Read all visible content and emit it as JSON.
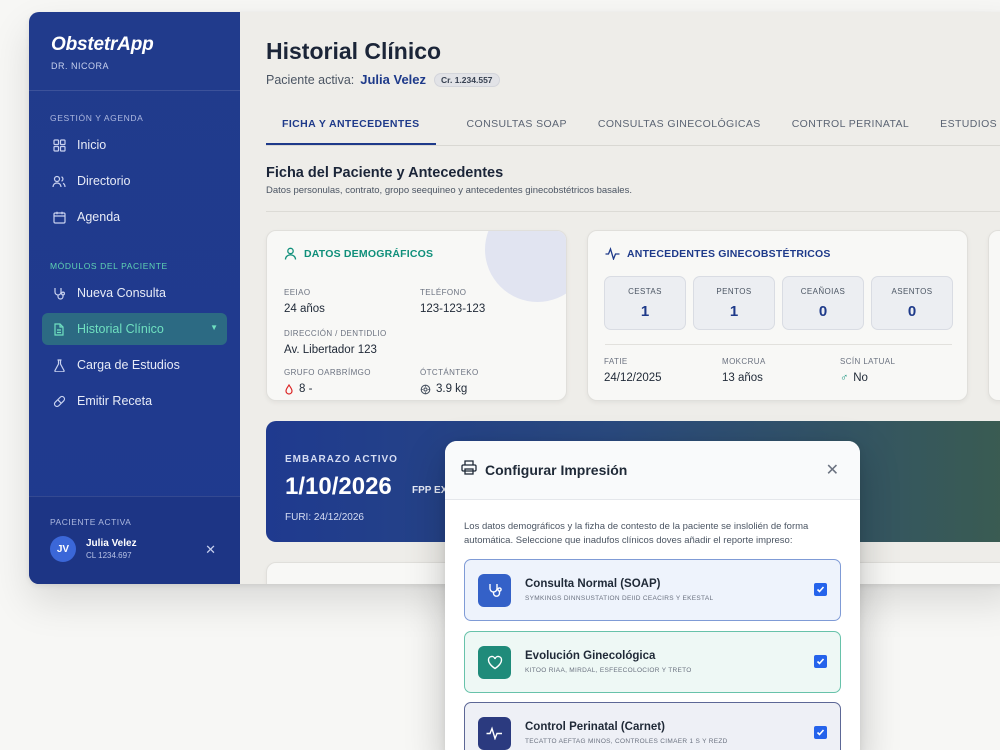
{
  "app": {
    "name": "ObstetrApp",
    "doctor": "DR. NICORA"
  },
  "sidebar": {
    "section1": "GESTIÓN Y AGENDA",
    "items1": [
      {
        "label": "Inicio",
        "icon": "grid-icon"
      },
      {
        "label": "Directorio",
        "icon": "users-icon"
      },
      {
        "label": "Agenda",
        "icon": "calendar-icon"
      }
    ],
    "section2": "MÓDULOS DEL PACIENTE",
    "items2": [
      {
        "label": "Nueva Consulta",
        "icon": "stethoscope-icon"
      },
      {
        "label": "Historial Clínico",
        "icon": "document-icon",
        "active": true
      },
      {
        "label": "Carga de Estudios",
        "icon": "flask-icon"
      },
      {
        "label": "Emitir Receta",
        "icon": "pill-icon"
      }
    ],
    "patient": {
      "label": "PACIENTE ACTIVA",
      "initials": "JV",
      "name": "Julia Velez",
      "id": "CL 1234.697"
    }
  },
  "header": {
    "title": "Historial Clínico",
    "patient_label": "Paciente activa:",
    "patient_name": "Julia Velez",
    "badge": "Cr. 1.234.557"
  },
  "tabs": [
    {
      "label": "FICHA Y ANTECEDENTES",
      "active": true
    },
    {
      "label": "CONSULTAS SOAP"
    },
    {
      "label": "CONSULTAS GINECOLÓGICAS"
    },
    {
      "label": "CONTROL PERINATAL"
    },
    {
      "label": "ESTUDIOS Y EXÁMENES"
    }
  ],
  "section": {
    "title": "Ficha del Paciente y Antecedentes",
    "description": "Datos personulas, contrato, gropo seequineo y antecedentes ginecobstétricos basales."
  },
  "demographics": {
    "title": "DATOS DEMOGRÁFICOS",
    "age_label": "EEIAO",
    "age": "24 años",
    "phone_label": "TELÉFONO",
    "phone": "123-123-123",
    "address_label": "DIRECCIÓN / DENTIDLIO",
    "address": "Av. Libertador 123",
    "blood_label": "GRUFO OARBRÍMGO",
    "blood": "8 -",
    "weight_label": "ÓTCTÁNTEKO",
    "weight": "3.9 kg"
  },
  "antecedents": {
    "title": "ANTECEDENTES GINECOBSTÉTRICOS",
    "stats": [
      {
        "label": "CESTAS",
        "value": "1"
      },
      {
        "label": "PENTOS",
        "value": "1"
      },
      {
        "label": "CEAÑOIAS",
        "value": "0"
      },
      {
        "label": "ASENTOS",
        "value": "0"
      }
    ],
    "date_label": "FATIE",
    "date": "24/12/2025",
    "age_label": "MOKCRUA",
    "age": "13 años",
    "status_label": "SCÍN LATUAL",
    "status": "No"
  },
  "pregnancy": {
    "label": "EMBARAZO ACTIVO",
    "date": "1/10/2026",
    "fpp": "FPP EX",
    "fur": "FURI: 24/12/2026"
  },
  "modal": {
    "title": "Configurar Impresión",
    "description": "Los datos demográficos y la fizha de contesto de la paciente se inslolién de forma automática. Seleccione que inadufos clínicos doves añadir el reporte impreso:",
    "options": [
      {
        "title": "Consulta Normal (SOAP)",
        "subtitle": "SYMKINGS DINNSUSTATION DEIID CEACIRS Y EKESTAL",
        "checked": true
      },
      {
        "title": "Evolución Ginecológica",
        "subtitle": "KITOO RIAA, MIRDAL, ESFEECOLOCIOR Y TRETO",
        "checked": true
      },
      {
        "title": "Control Perinatal (Carnet)",
        "subtitle": "TECATTO AEFTAG MINOS, CONTROLES CIMAER 1 S Y REZD",
        "checked": true
      }
    ]
  },
  "colors": {
    "sidebar": "#213b8c",
    "accent": "#1e3a8a",
    "teal": "#0f8f7a",
    "check": "#2563eb"
  }
}
